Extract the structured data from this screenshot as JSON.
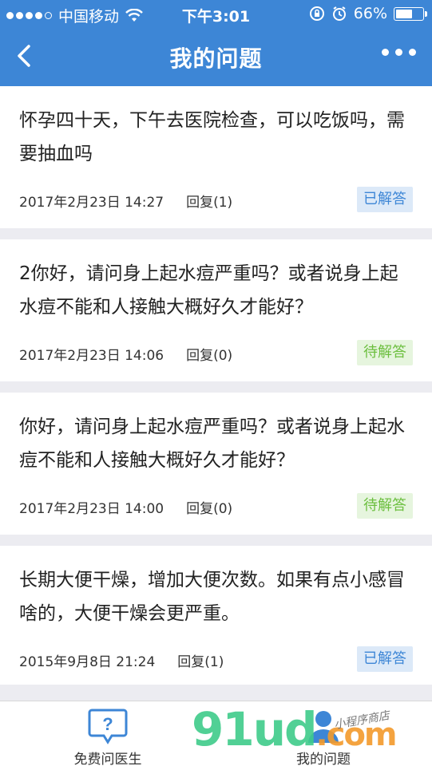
{
  "status_bar": {
    "carrier": "中国移动",
    "time": "下午3:01",
    "battery_percent": "66%",
    "battery_level": 0.66
  },
  "nav": {
    "title": "我的问题",
    "back_icon": "chevron-left-icon",
    "more_icon": "more-dots-icon"
  },
  "questions": [
    {
      "text": "怀孕四十天，下午去医院检查，可以吃饭吗，需要抽血吗",
      "date": "2017年2月23日 14:27",
      "reply": "回复(1)",
      "status": "已解答",
      "status_type": "answered"
    },
    {
      "text": "2你好，请问身上起水痘严重吗？或者说身上起水痘不能和人接触大概好久才能好？",
      "date": "2017年2月23日 14:06",
      "reply": "回复(0)",
      "status": "待解答",
      "status_type": "pending"
    },
    {
      "text": "你好，请问身上起水痘严重吗？或者说身上起水痘不能和人接触大概好久才能好？",
      "date": "2017年2月23日 14:00",
      "reply": "回复(0)",
      "status": "待解答",
      "status_type": "pending"
    },
    {
      "text": "长期大便干燥，增加大便次数。如果有点小感冒啥的，大便干燥会更严重。",
      "date": "2015年9月8日 21:24",
      "reply": "回复(1)",
      "status": "已解答",
      "status_type": "answered"
    }
  ],
  "tabs": [
    {
      "label": "免费问医生",
      "icon": "chat-question-icon"
    },
    {
      "label": "我的问题",
      "icon": "person-icon"
    }
  ],
  "watermark": {
    "text": "91ud",
    "suffix": ".com",
    "note": "小程序商店"
  },
  "colors": {
    "brand": "#3d86d6",
    "answered_bg": "#dce9f8",
    "pending_bg": "#e6f5de",
    "pending_text": "#6cbf3f"
  }
}
